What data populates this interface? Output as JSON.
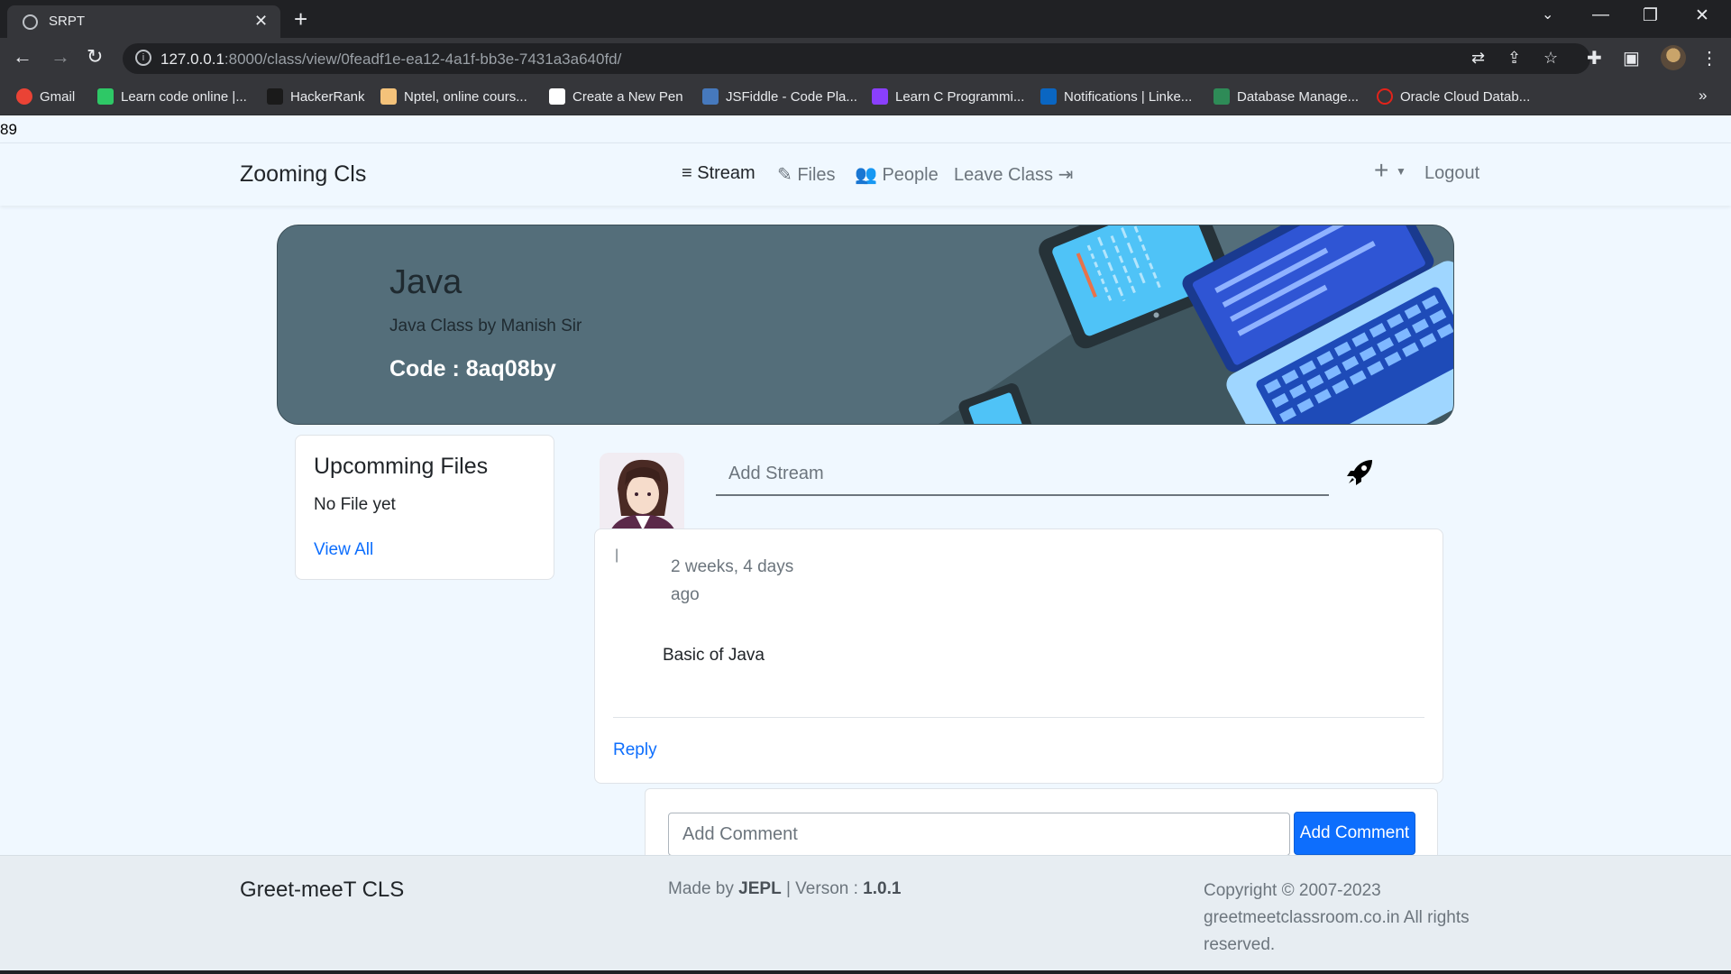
{
  "browser": {
    "tab_title": "SRPT",
    "url_host": "127.0.0.1",
    "url_rest": ":8000/class/view/0feadf1e-ea12-4a1f-bb3e-7431a3a640fd/",
    "bookmarks": [
      {
        "label": "Gmail",
        "color": "#ea4335"
      },
      {
        "label": "Learn code online |...",
        "color": "#2ec866"
      },
      {
        "label": "HackerRank",
        "color": "#1a1a1a"
      },
      {
        "label": "Nptel, online cours...",
        "color": "#f4c27a"
      },
      {
        "label": "Create a New Pen",
        "color": "#ffffff"
      },
      {
        "label": "JSFiddle - Code Pla...",
        "color": "#4679bd"
      },
      {
        "label": "Learn C Programmi...",
        "color": "#8a3ffc"
      },
      {
        "label": "Notifications | Linke...",
        "color": "#0a66c2"
      },
      {
        "label": "Database Manage...",
        "color": "#2e8b57"
      },
      {
        "label": "Oracle Cloud Datab...",
        "color": "#e2231a"
      }
    ]
  },
  "debug_counter": "89",
  "navbar": {
    "brand": "Zooming Cls",
    "stream": "Stream",
    "files": "Files",
    "people": "People",
    "leave": "Leave Class",
    "logout": "Logout"
  },
  "banner": {
    "title": "Java",
    "subtitle": "Java Class by Manish Sir",
    "code": "Code : 8aq08by"
  },
  "files_card": {
    "title": "Upcomming Files",
    "empty": "No File yet",
    "link": "View All"
  },
  "stream": {
    "placeholder": "Add Stream"
  },
  "post": {
    "mark": "|",
    "time": "2 weeks, 4 days ago",
    "body": "Basic of Java",
    "reply": "Reply"
  },
  "comment": {
    "placeholder": "Add Comment",
    "button": "Add Comment"
  },
  "footer": {
    "brand": "Greet-meeT CLS",
    "made_prefix": "Made by ",
    "made_by": "JEPL",
    "version_prefix": " | Verson : ",
    "version": "1.0.1",
    "copyright": "Copyright © 2007-2023 greetmeetclassroom.co.in All rights reserved."
  }
}
